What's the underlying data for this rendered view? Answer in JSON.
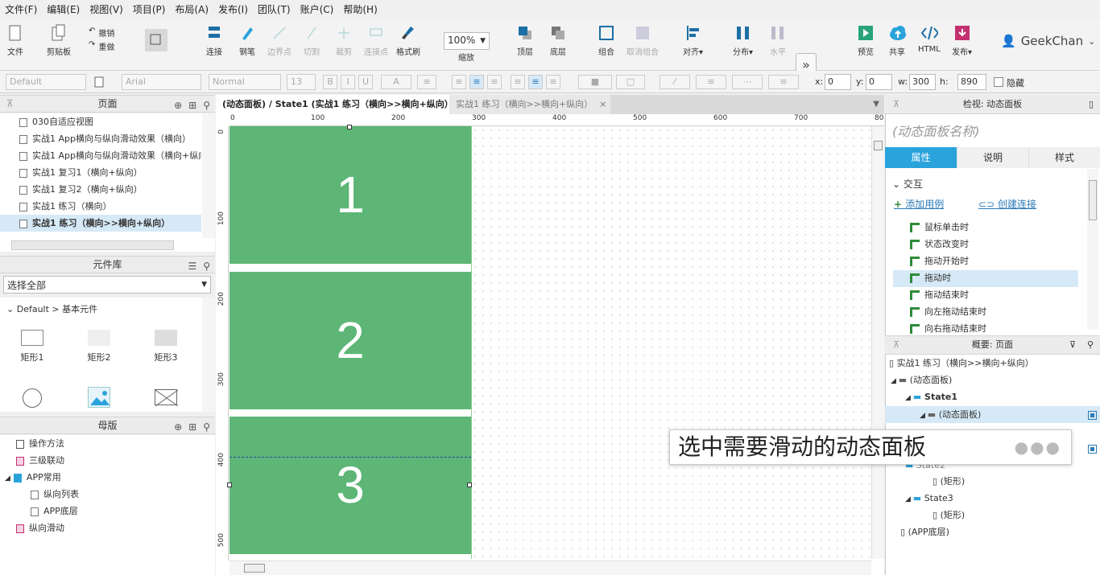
{
  "menu": [
    "文件(F)",
    "编辑(E)",
    "视图(V)",
    "项目(P)",
    "布局(A)",
    "发布(I)",
    "团队(T)",
    "账户(C)",
    "帮助(H)"
  ],
  "toolbar": {
    "file": "文件",
    "clipboard": "剪贴板",
    "undo": "撤销",
    "redo": "重做",
    "select": "选择",
    "connect": "连接",
    "pen": "钢笔",
    "boundary": "边界点",
    "cut": "切割",
    "crop": "裁剪",
    "connector_point": "连接点",
    "format_painter": "格式刷",
    "zoom_value": "100%",
    "zoom_label": "缩放",
    "top": "顶层",
    "bottom": "底层",
    "group": "组合",
    "ungroup": "取消组合",
    "align": "对齐▾",
    "distribute": "分布▾",
    "horizontal": "水平",
    "preview": "预览",
    "share": "共享",
    "html": "HTML",
    "publish": "发布▾",
    "user": "GeekChan"
  },
  "format": {
    "style": "Default",
    "font": "Arial",
    "weight": "Normal",
    "size": "13",
    "x_label": "x:",
    "x": "0",
    "y_label": "y:",
    "y": "0",
    "w_label": "w:",
    "w": "300",
    "h_label": "h:",
    "h": "890",
    "hidden": "隐藏"
  },
  "pages_panel": {
    "title": "页面",
    "items": [
      "030自适应视图",
      "实战1 App横向与纵向滑动效果（横向）",
      "实战1 App横向与纵向滑动效果（横向+纵向",
      "实战1 复习1（横向+纵向）",
      "实战1 复习2（横向+纵向）",
      "实战1 练习（横向）",
      "实战1 练习（横向>>横向+纵向）"
    ]
  },
  "library_panel": {
    "title": "元件库",
    "select": "选择全部",
    "group": "Default > 基本元件",
    "items": [
      "矩形1",
      "矩形2",
      "矩形3"
    ]
  },
  "masters_panel": {
    "title": "母版",
    "items": [
      "操作方法",
      "三级联动",
      "APP常用",
      "纵向列表",
      "APP底层",
      "纵向滑动"
    ]
  },
  "tabs": {
    "active": "(动态面板) / State1 (实战1 练习（横向>>横向+纵向）)",
    "inactive": "实战1 练习（横向>>横向+纵向）"
  },
  "ruler": {
    "top": [
      "0",
      "100",
      "200",
      "300",
      "400",
      "500",
      "600",
      "700",
      "80"
    ],
    "left": [
      "0",
      "100",
      "200",
      "300",
      "400",
      "500"
    ]
  },
  "canvas": {
    "blocks": [
      "1",
      "2",
      "3"
    ]
  },
  "inspector": {
    "title": "检视: 动态面板",
    "name_placeholder": "(动态面板名称)",
    "tabs": [
      "属性",
      "说明",
      "样式"
    ],
    "section": "交互",
    "add_case": "添加用例",
    "create_link": "创建连接",
    "events": [
      "鼠标单击时",
      "状态改变时",
      "拖动开始时",
      "拖动时",
      "拖动结束时",
      "向左拖动结束时",
      "向右拖动结束时"
    ]
  },
  "outline": {
    "title": "概要: 页面",
    "page": "实战1 练习（横向>>横向+纵向）",
    "panel": "(动态面板)",
    "state1": "State1",
    "inner_panel": "(动态面板)",
    "state2": "State2",
    "rect": "(矩形)",
    "state3": "State3",
    "rect2": "(矩形)",
    "app_bottom": "(APP底层)"
  },
  "tooltip": "选中需要滑动的动态面板",
  "colors": {
    "accent": "#2aa3dc",
    "block": "#5db676"
  }
}
